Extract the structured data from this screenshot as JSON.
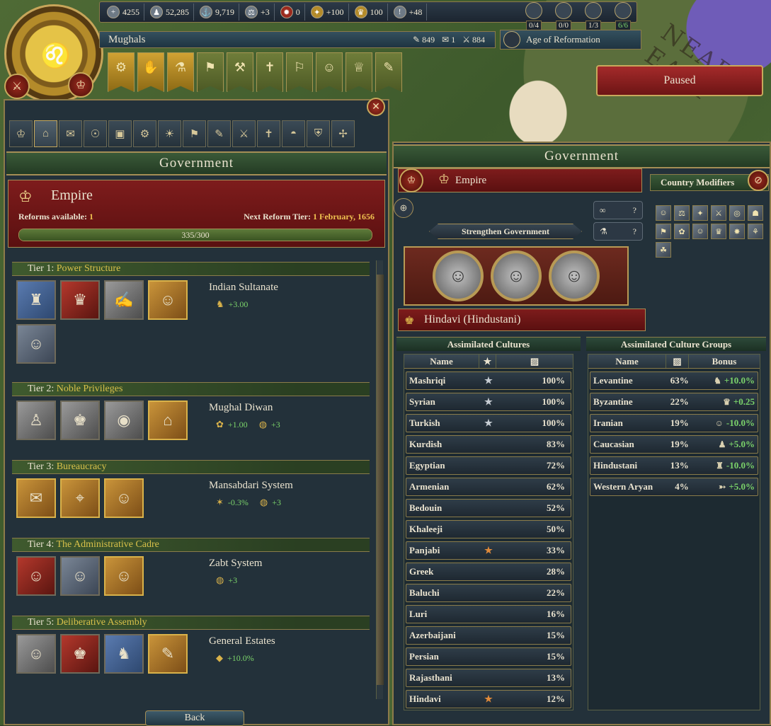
{
  "topbar": {
    "resources": [
      {
        "icon": "manpower-plus-icon",
        "value": "4255"
      },
      {
        "icon": "manpower-icon",
        "value": "52,285"
      },
      {
        "icon": "sailors-icon",
        "value": "9,719"
      },
      {
        "icon": "stability-icon",
        "value": "+3"
      },
      {
        "icon": "corruption-icon",
        "value": "0"
      },
      {
        "icon": "prestige-icon",
        "value": "+100"
      },
      {
        "icon": "legitimacy-icon",
        "value": "100"
      },
      {
        "icon": "power-projection-icon",
        "value": "+48"
      }
    ],
    "leaders": [
      "0/4",
      "0/0",
      "1/3",
      "6/6"
    ]
  },
  "country": {
    "name": "Mughals",
    "stats": [
      {
        "icon": "admin-icon",
        "value": "849"
      },
      {
        "icon": "diplo-icon",
        "value": "1"
      },
      {
        "icon": "military-icon",
        "value": "884"
      }
    ],
    "age": "Age of Reformation"
  },
  "status": {
    "paused": "Paused"
  },
  "tabs": [
    "crown",
    "government",
    "diplomacy",
    "economy",
    "trade",
    "technology",
    "ideas",
    "missions",
    "decisions",
    "military",
    "religion",
    "estates",
    "subjects",
    "missions2"
  ],
  "left": {
    "title": "Government",
    "gov_type": "Empire",
    "reforms_label": "Reforms available:",
    "reforms_value": "1",
    "next_label": "Next Reform Tier:",
    "next_value": "1 February, 1656",
    "progress_text": "335/300",
    "progress_fraction": 1.0,
    "tiers": [
      {
        "label": "Tier 1:",
        "name": "Power Structure",
        "reform": "Indian Sultanate",
        "effects": [
          {
            "icon": "army-icon",
            "value": "+3.00"
          }
        ]
      },
      {
        "label": "Tier 2:",
        "name": "Noble Privileges",
        "reform": "Mughal Diwan",
        "effects": [
          {
            "icon": "tax-icon",
            "value": "+1.00"
          },
          {
            "icon": "gold-icon",
            "value": "+3"
          }
        ]
      },
      {
        "label": "Tier 3:",
        "name": "Bureaucracy",
        "reform": "Mansabdari System",
        "effects": [
          {
            "icon": "autonomy-icon",
            "value": "-0.3%"
          },
          {
            "icon": "gold-icon",
            "value": "+3"
          }
        ]
      },
      {
        "label": "Tier 4:",
        "name": "The Administrative Cadre",
        "reform": "Zabt System",
        "effects": [
          {
            "icon": "gold-icon",
            "value": "+3"
          }
        ]
      },
      {
        "label": "Tier 5:",
        "name": "Deliberative Assembly",
        "reform": "General Estates",
        "effects": [
          {
            "icon": "estate-icon",
            "value": "+10.0%"
          }
        ]
      }
    ],
    "back": "Back"
  },
  "right": {
    "title": "Government",
    "gov_type": "Empire",
    "country_modifiers": "Country Modifiers",
    "ability_marks": [
      "?",
      "?"
    ],
    "strengthen": "Strengthen Government",
    "culture": "Hindavi (Hindustani)",
    "cultures_head": "Assimilated Cultures",
    "groups_head": "Assimilated Culture Groups",
    "col_name": "Name",
    "col_bonus": "Bonus",
    "cultures": [
      {
        "name": "Mashriqi",
        "star": "silver",
        "pct": "100%"
      },
      {
        "name": "Syrian",
        "star": "silver",
        "pct": "100%"
      },
      {
        "name": "Turkish",
        "star": "silver",
        "pct": "100%"
      },
      {
        "name": "Kurdish",
        "star": "",
        "pct": "83%"
      },
      {
        "name": "Egyptian",
        "star": "",
        "pct": "72%"
      },
      {
        "name": "Armenian",
        "star": "",
        "pct": "62%"
      },
      {
        "name": "Bedouin",
        "star": "",
        "pct": "52%"
      },
      {
        "name": "Khaleeji",
        "star": "",
        "pct": "50%"
      },
      {
        "name": "Panjabi",
        "star": "gold",
        "pct": "33%"
      },
      {
        "name": "Greek",
        "star": "",
        "pct": "28%"
      },
      {
        "name": "Baluchi",
        "star": "",
        "pct": "22%"
      },
      {
        "name": "Luri",
        "star": "",
        "pct": "16%"
      },
      {
        "name": "Azerbaijani",
        "star": "",
        "pct": "15%"
      },
      {
        "name": "Persian",
        "star": "",
        "pct": "15%"
      },
      {
        "name": "Rajasthani",
        "star": "",
        "pct": "13%"
      },
      {
        "name": "Hindavi",
        "star": "gold",
        "pct": "12%"
      }
    ],
    "groups": [
      {
        "name": "Levantine",
        "pct": "63%",
        "icon": "cavalry-icon",
        "bonus": "+10.0%"
      },
      {
        "name": "Byzantine",
        "pct": "22%",
        "icon": "crown-icon",
        "bonus": "+0.25"
      },
      {
        "name": "Iranian",
        "pct": "19%",
        "icon": "advisor-icon",
        "bonus": "-10.0%"
      },
      {
        "name": "Caucasian",
        "pct": "19%",
        "icon": "infantry-icon",
        "bonus": "+5.0%"
      },
      {
        "name": "Hindustani",
        "pct": "13%",
        "icon": "elephant-icon",
        "bonus": "-10.0%"
      },
      {
        "name": "Western Aryan",
        "pct": "4%",
        "icon": "cannon-icon",
        "bonus": "+5.0%"
      }
    ]
  }
}
